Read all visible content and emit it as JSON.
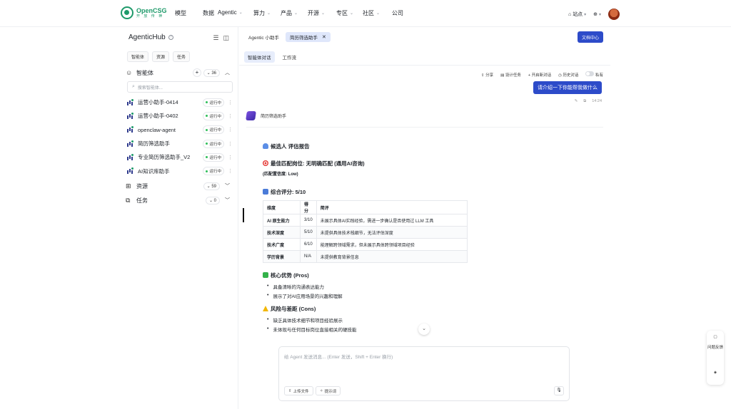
{
  "brand": {
    "name": "OpenCSG",
    "subtitle": "开 放 传 神"
  },
  "nav": [
    {
      "label": "模型",
      "has_menu": false
    },
    {
      "label": "数据",
      "has_menu": false
    },
    {
      "label": "Agentic",
      "has_menu": true
    },
    {
      "label": "算力",
      "has_menu": true
    },
    {
      "label": "产品",
      "has_menu": true
    },
    {
      "label": "开源",
      "has_menu": true
    },
    {
      "label": "专区",
      "has_menu": true
    },
    {
      "label": "社区",
      "has_menu": true
    },
    {
      "label": "公司",
      "has_menu": false
    }
  ],
  "topright": {
    "org_label": "站点",
    "lang_icon": "globe-icon"
  },
  "sidebar": {
    "title": "AgenticHub",
    "tabs": [
      "智能体",
      "资源",
      "任务"
    ],
    "agents_section": {
      "label": "智能体",
      "count": "36"
    },
    "search_placeholder": "搜索智能体...",
    "agents": [
      {
        "name": "运营小助手-0414",
        "status": "运行中"
      },
      {
        "name": "运营小助手-0402",
        "status": "运行中"
      },
      {
        "name": "openclaw-agent",
        "status": "运行中"
      },
      {
        "name": "简历筛选助手",
        "status": "运行中"
      },
      {
        "name": "专业简历筛选助手_V2",
        "status": "运行中"
      },
      {
        "name": "AI知识库助手",
        "status": "运行中"
      }
    ],
    "resources_section": {
      "label": "资源",
      "count": "59"
    },
    "tasks_section": {
      "label": "任务",
      "count": "0"
    }
  },
  "main": {
    "tabs": [
      {
        "label": "Agentic 小助手",
        "active": false
      },
      {
        "label": "简历筛选助手",
        "active": true
      }
    ],
    "doc_button": "文档中心",
    "subtabs": [
      {
        "label": "智能体对话",
        "active": true
      },
      {
        "label": "工作流",
        "active": false
      }
    ],
    "chat_tools": {
      "share": "分享",
      "design": "设计任务",
      "new_chat": "开启新对话",
      "history": "历史对话",
      "privacy": "私有"
    },
    "user_message": "请介绍一下你能帮我做什么",
    "message_time": "14:24",
    "bot_name": "简历筛选助手",
    "report": {
      "title": "候选人 评估报告",
      "best_match": "最佳匹配岗位: 无明确匹配 (通用AI咨询)",
      "confidence": "(匹配置信度: Low)",
      "score": "综合评分: 5/10",
      "table_headers": [
        "维度",
        "得分",
        "简评"
      ],
      "table_rows": [
        [
          "AI 原生能力",
          "3/10",
          "未展示具体AI实践经验，需进一步确认是否使用过 LLM 工具"
        ],
        [
          "技术深度",
          "5/10",
          "未提供具体技术栈细节，无法评估深度"
        ],
        [
          "技术广度",
          "6/10",
          "能理解跨领域需求，但未展示具体跨领域项目经验"
        ],
        [
          "学历背景",
          "N/A",
          "未提供教育背景信息"
        ]
      ],
      "pros_title": "核心优势 (Pros)",
      "pros": [
        "具备清晰的沟通表达能力",
        "展示了对AI应用场景的兴趣和理解"
      ],
      "cons_title": "风险与差距 (Cons)",
      "cons": [
        "缺乏具体技术细节和项目经验展示",
        "未体现与任何目标岗位直接相关的硬技能"
      ]
    },
    "input_placeholder": "给 Agent 发送消息... (Enter 发送，Shift + Enter 换行)",
    "upload_button": "上传文件",
    "prompt_button": "提示词"
  },
  "float_panel": {
    "feedback": "问题反馈"
  },
  "colors": {
    "brand_green": "#1e9a6a",
    "primary_blue": "#2d4bc9",
    "active_tab_bg": "#dfe7fb",
    "status_green": "#2fbf5a"
  }
}
